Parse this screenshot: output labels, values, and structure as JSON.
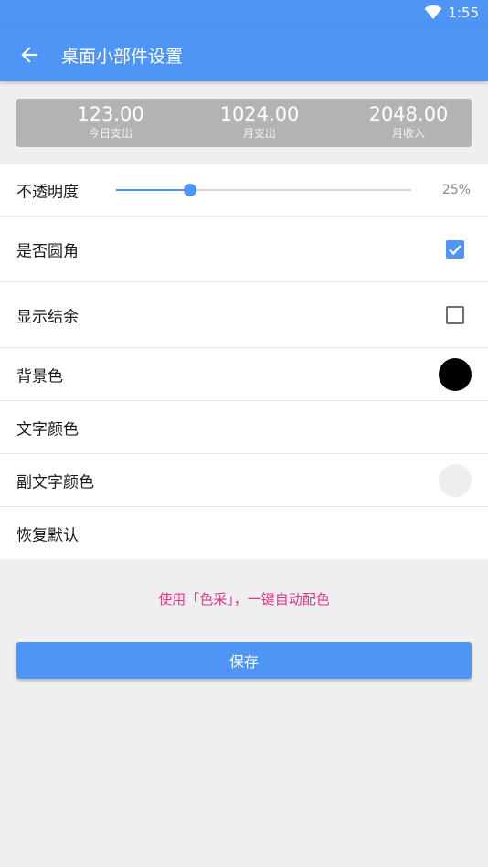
{
  "status_bar": {
    "time": "1:55",
    "wifi_icon": "wifi-icon"
  },
  "app_bar": {
    "title": "桌面小部件设置",
    "back_icon": "arrow-back-icon"
  },
  "preview": {
    "stats": [
      {
        "value": "123.00",
        "label": "今日支出"
      },
      {
        "value": "1024.00",
        "label": "月支出"
      },
      {
        "value": "2048.00",
        "label": "月收入"
      }
    ]
  },
  "settings": {
    "opacity": {
      "label": "不透明度",
      "value_text": "25%",
      "value": 0.25
    },
    "rounded_corners": {
      "label": "是否圆角",
      "checked": true
    },
    "show_balance": {
      "label": "显示结余",
      "checked": false
    },
    "background_color": {
      "label": "背景色",
      "color": "#000000"
    },
    "text_color": {
      "label": "文字颜色",
      "color": "#ffffff"
    },
    "subtext_color": {
      "label": "副文字颜色",
      "color": "#eeeeee"
    },
    "reset": {
      "label": "恢复默认"
    }
  },
  "tip": "使用「色采」，一键自动配色",
  "save_label": "保存",
  "colors": {
    "primary": "#4e95f5",
    "tip": "#e0348a"
  }
}
